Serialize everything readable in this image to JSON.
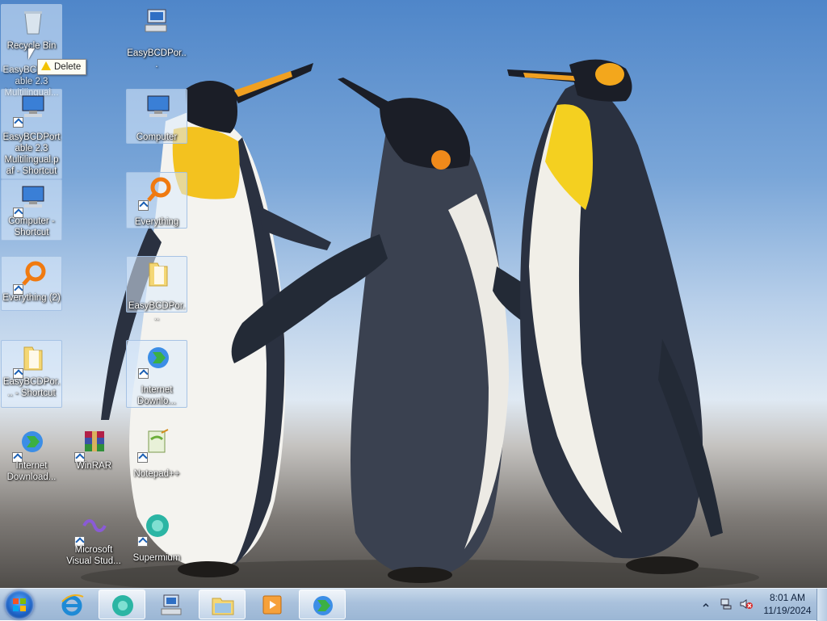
{
  "desktop": {
    "icons": [
      {
        "label": "Recycle Bin",
        "name": "recycle-bin"
      },
      {
        "label": "EasyBCDPortable 2.3 Multilingual...",
        "name": "easybcd-installer"
      },
      {
        "label": "EasyBCDPortable 2.3 Multilingual.paf - Shortcut",
        "name": "easybcd-paf-shortcut"
      },
      {
        "label": "Computer - Shortcut",
        "name": "computer-shortcut"
      },
      {
        "label": "Everything (2)",
        "name": "everything-2"
      },
      {
        "label": "EasyBCDPor... - Shortcut",
        "name": "easybcd-folder-shortcut"
      },
      {
        "label": "Internet Download...",
        "name": "internet-download-1"
      },
      {
        "label": "WinRAR",
        "name": "winrar"
      },
      {
        "label": "Microsoft Visual Stud...",
        "name": "visual-studio"
      },
      {
        "label": "EasyBCDPor...",
        "name": "easybcd-portable"
      },
      {
        "label": "Computer",
        "name": "computer"
      },
      {
        "label": "Everything",
        "name": "everything"
      },
      {
        "label": "EasyBCDPor...",
        "name": "easybcd-folder"
      },
      {
        "label": "Internet Downlo...",
        "name": "internet-download-2"
      },
      {
        "label": "Notepad++",
        "name": "notepad-plus-plus"
      },
      {
        "label": "Supermium",
        "name": "supermium"
      }
    ],
    "tooltip": "Delete"
  },
  "taskbar": {
    "clock_time": "8:01 AM",
    "clock_date": "11/19/2024"
  },
  "colors": {
    "taskbar": "#a9c1dc",
    "sky": "#7aa6d8",
    "ground": "#7f7b77"
  }
}
